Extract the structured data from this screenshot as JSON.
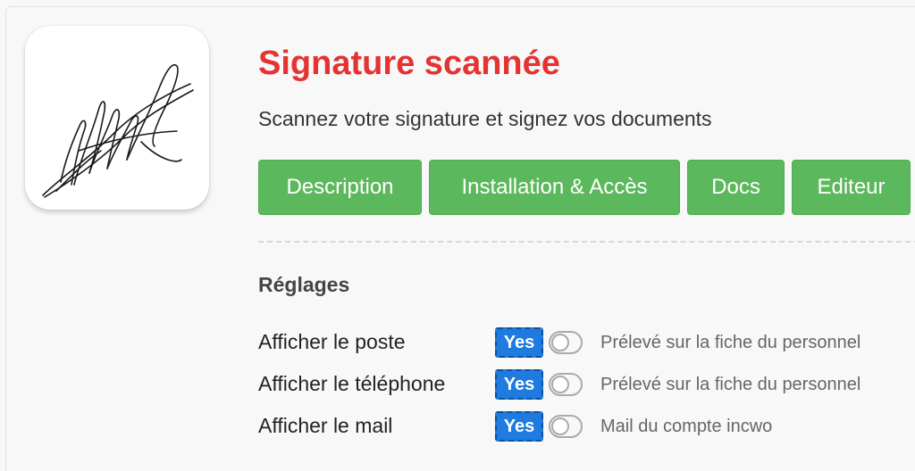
{
  "header": {
    "title": "Signature scannée",
    "subtitle": "Scannez votre signature et signez vos documents",
    "icon": "signature-icon"
  },
  "nav": {
    "buttons": [
      {
        "label": "Description"
      },
      {
        "label": "Installation & Accès"
      },
      {
        "label": "Docs"
      },
      {
        "label": "Editeur"
      }
    ]
  },
  "settings": {
    "title": "Réglages",
    "rows": [
      {
        "label": "Afficher le poste",
        "value": "Yes",
        "hint": "Prélevé sur la fiche du personnel"
      },
      {
        "label": "Afficher le téléphone",
        "value": "Yes",
        "hint": "Prélevé sur la fiche du personnel"
      },
      {
        "label": "Afficher le mail",
        "value": "Yes",
        "hint": "Mail du compte incwo"
      }
    ]
  },
  "colors": {
    "title": "#e53232",
    "button": "#5cb85c",
    "yes_badge": "#1f7be0"
  }
}
